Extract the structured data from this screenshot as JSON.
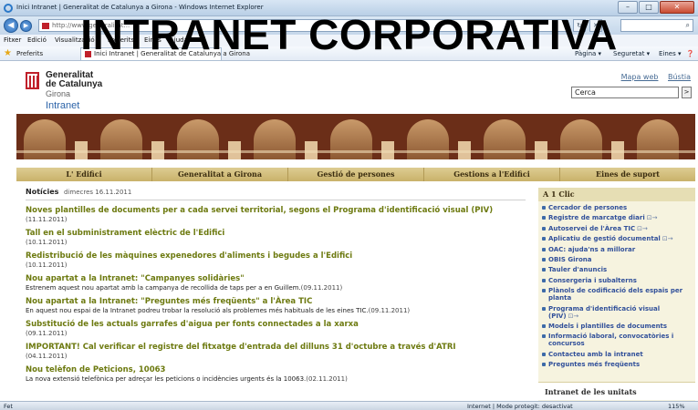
{
  "browser": {
    "window_title": "Inici Intranet | Generalitat de Catalunya a Girona - Windows Internet Explorer",
    "url": "http://www.generalitat...",
    "menu": [
      "Fitxer",
      "Edició",
      "Visualització",
      "Preferits",
      "Eines",
      "Ajuda"
    ],
    "favorites_label": "Preferits",
    "tab_title": "Inici Intranet | Generalitat de Catalunya a Girona",
    "tools": [
      "Pàgina ▾",
      "Seguretat ▾",
      "Eines ▾"
    ],
    "status_left": "Fet",
    "status_zone": "Internet | Mode protegit: desactivat",
    "zoom": "115%"
  },
  "overlay_title": "INTRANET CORPORATIVA",
  "header": {
    "logo_line1": "Generalitat",
    "logo_line2": "de Catalunya",
    "logo_line3": "Girona",
    "logo_line4": "Intranet",
    "link_map": "Mapa web",
    "link_mailbox": "Bústia",
    "search_value": "Cerca",
    "search_button": ">"
  },
  "nav": [
    "L' Edifici",
    "Generalitat a Girona",
    "Gestió de persones",
    "Gestions a l'Edifici",
    "Eines de suport"
  ],
  "news": {
    "heading": "Notícies",
    "date": "dimecres 16.11.2011",
    "items": [
      {
        "title": "Noves plantilles de documents per a cada servei territorial, segons el Programa d'identificació visual (PIV)",
        "body": "",
        "date": "(11.11.2011)"
      },
      {
        "title": "Tall en el subministrament elèctric de l'Edifici",
        "body": "",
        "date": "(10.11.2011)"
      },
      {
        "title": "Redistribució de les màquines expenedores d'aliments i begudes a l'Edifici",
        "body": "",
        "date": "(10.11.2011)"
      },
      {
        "title": "Nou apartat a la Intranet: \"Campanyes solidàries\"",
        "body": "Estrenem aquest nou apartat amb la campanya de recollida de taps per a en Guillem.",
        "date": "(09.11.2011)"
      },
      {
        "title": "Nou apartat a la Intranet: \"Preguntes més freqüents\" a l'Àrea TIC",
        "body": "En aquest nou espai de la Intranet podreu trobar la resolució als problemes més habituals de les eines TIC.",
        "date": "(09.11.2011)"
      },
      {
        "title": "Substitució de les actuals garrafes d'aigua per fonts connectades a la xarxa",
        "body": "",
        "date": "(09.11.2011)"
      },
      {
        "title": "IMPORTANT! Cal verificar el registre del fitxatge d'entrada del dilluns 31 d'octubre a través d'ATRI",
        "body": "",
        "date": "(04.11.2011)"
      },
      {
        "title": "Nou telèfon de Peticions, 10063",
        "body": "La nova extensió telefònica per adreçar les peticions o incidències urgents és la 10063.",
        "date": "(02.11.2011)"
      }
    ]
  },
  "sidebar": {
    "heading": "A 1 Clic",
    "items": [
      {
        "label": "Cercador de persones",
        "ext": ""
      },
      {
        "label": "Registre de marcatge diari",
        "ext": "⊡→"
      },
      {
        "label": "Autoservei de l'Àrea TIC",
        "ext": "⊡→"
      },
      {
        "label": "Aplicatiu de gestió documental",
        "ext": "⊡→"
      },
      {
        "label": "OAC: ajuda'ns a millorar",
        "ext": ""
      },
      {
        "label": "OBIS Girona",
        "ext": ""
      },
      {
        "label": "Tauler d'anuncis",
        "ext": ""
      },
      {
        "label": "Consergeria i subalterns",
        "ext": ""
      },
      {
        "label": "Plànols de codificació dels espais per planta",
        "ext": ""
      },
      {
        "label": "Programa d'identificació visual (PIV)",
        "ext": "⊡→"
      },
      {
        "label": "Models i plantilles de documents",
        "ext": ""
      },
      {
        "label": "Informació laboral, convocatòries i concursos",
        "ext": ""
      },
      {
        "label": "Contacteu amb la intranet",
        "ext": ""
      },
      {
        "label": "Preguntes més freqüents",
        "ext": ""
      }
    ],
    "heading2": "Intranet de les unitats"
  },
  "colors": {
    "news_title": "#6d7a10",
    "link_blue": "#31509a",
    "nav_bg": "#c9b26a",
    "brand_red": "#c0202a"
  }
}
